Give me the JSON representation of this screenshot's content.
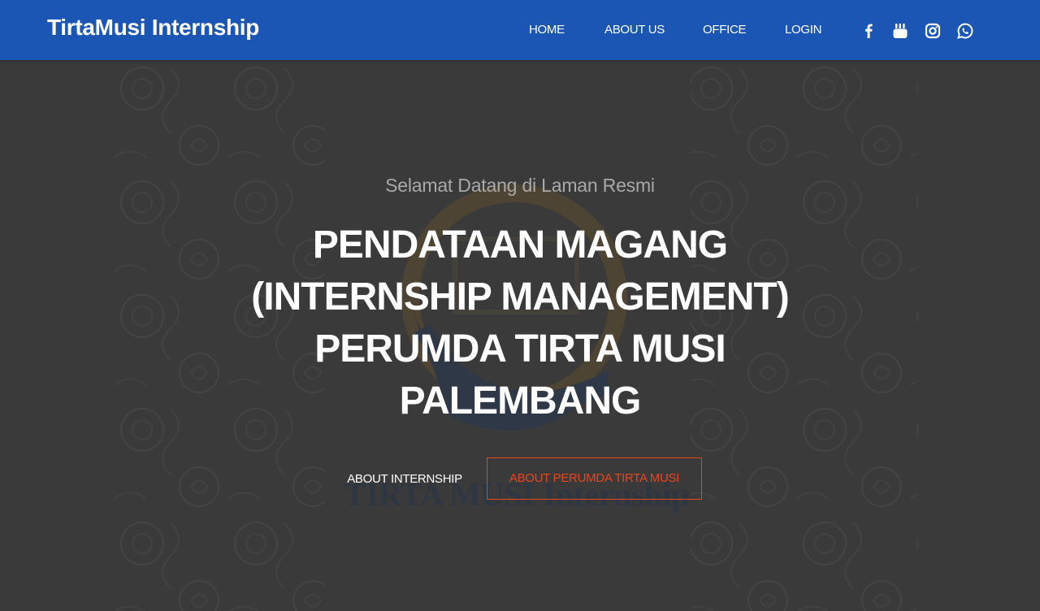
{
  "brand": "TirtaMusi Internship",
  "nav": {
    "home": "HOME",
    "about": "ABOUT US",
    "office": "OFFICE",
    "login": "LOGIN"
  },
  "social": [
    "facebook-icon",
    "youtube-icon",
    "instagram-icon",
    "whatsapp-icon"
  ],
  "hero": {
    "subtitle": "Selamat Datang di Laman Resmi",
    "title_lines": [
      "PENDATAAN MAGANG",
      "(INTERNSHIP MANAGEMENT)",
      "PERUMDA TIRTA MUSI",
      "PALEMBANG"
    ],
    "button_internship": "ABOUT INTERNSHIP",
    "button_perumda": "ABOUT PERUMDA TIRTA MUSI",
    "watermark_text": "TIRTA MUSI  Internship"
  },
  "colors": {
    "navbar": "#1b56b4",
    "hero_bg": "#3a3a3b",
    "accent": "#e8461f"
  }
}
